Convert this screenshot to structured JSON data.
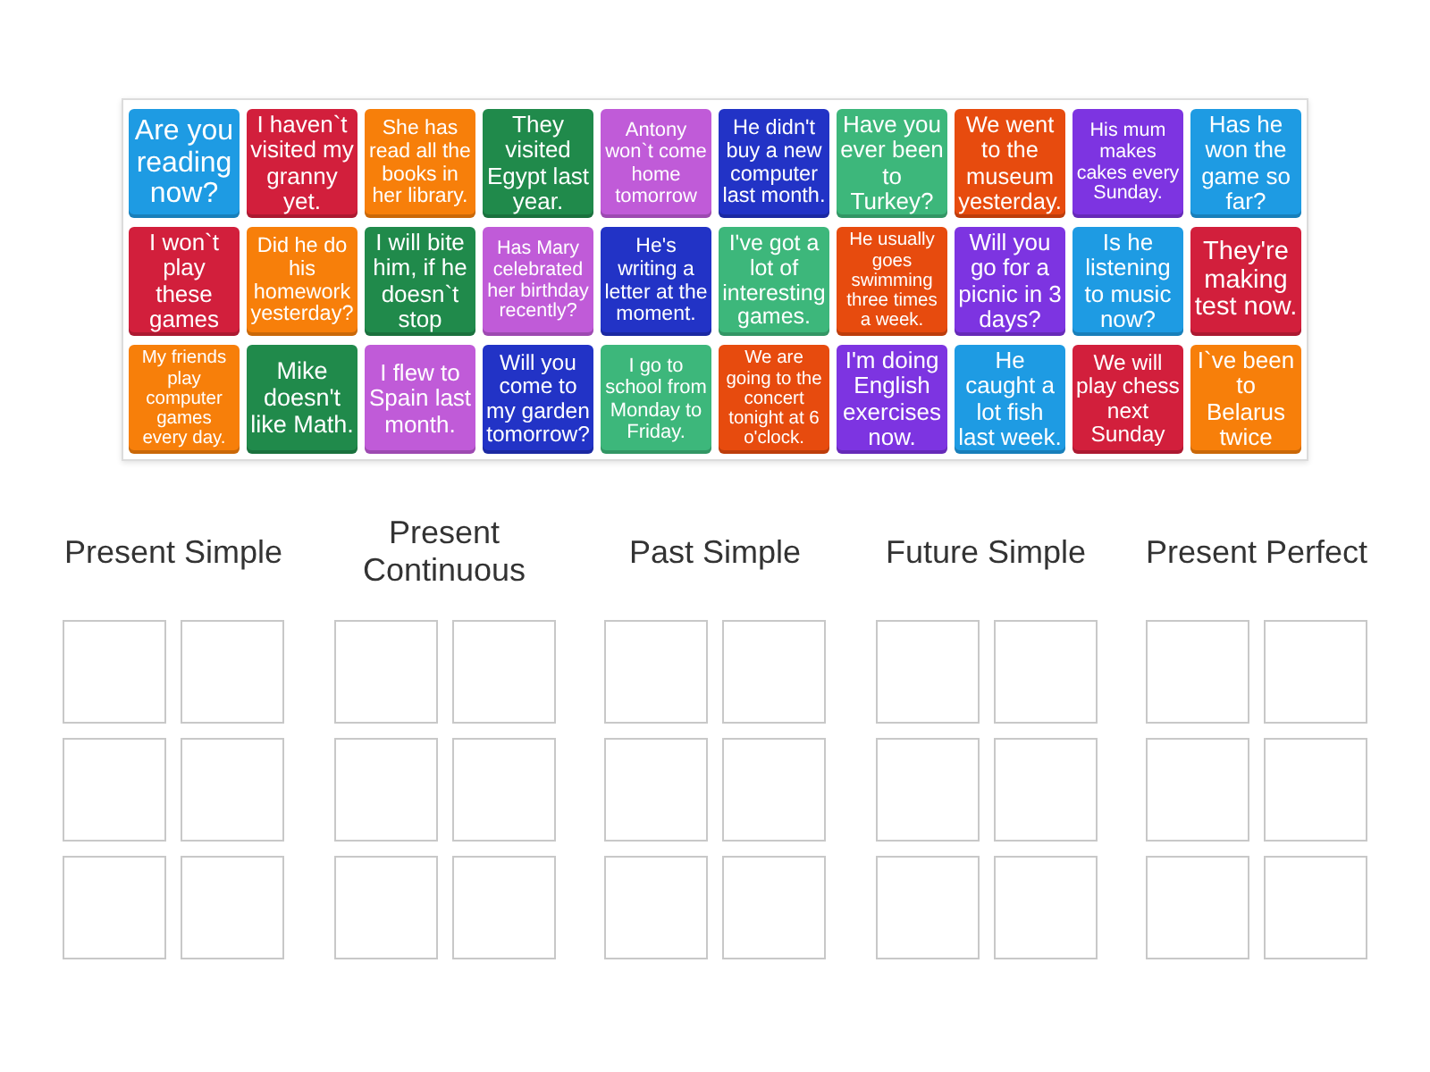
{
  "cards": [
    {
      "text": "Are you reading now?",
      "color": "#1e9be3"
    },
    {
      "text": "I haven`t visited my granny yet.",
      "color": "#d21f3c"
    },
    {
      "text": "She has read all the books in her library.",
      "color": "#f77f0a"
    },
    {
      "text": "They visited Egypt last year.",
      "color": "#208a4b"
    },
    {
      "text": "Antony won`t come home tomorrow",
      "color": "#c05bd8"
    },
    {
      "text": "He didn't buy a new computer last month.",
      "color": "#2233c6"
    },
    {
      "text": "Have you ever been to Turkey?",
      "color": "#3db77b"
    },
    {
      "text": "We went to the museum yesterday.",
      "color": "#e74b0e"
    },
    {
      "text": "His mum makes cakes every Sunday.",
      "color": "#7d34e1"
    },
    {
      "text": "Has he won the game so far?",
      "color": "#1e9be3"
    },
    {
      "text": "I won`t play these games",
      "color": "#d21f3c"
    },
    {
      "text": "Did he do his homework yesterday?",
      "color": "#f77f0a"
    },
    {
      "text": "I will bite him, if he doesn`t stop",
      "color": "#208a4b"
    },
    {
      "text": "Has Mary celebrated her birthday recently?",
      "color": "#c05bd8"
    },
    {
      "text": "He's writing a letter at the moment.",
      "color": "#2233c6"
    },
    {
      "text": "I've got a lot of interesting games.",
      "color": "#3db77b"
    },
    {
      "text": "He usually goes swimming three times a week.",
      "color": "#e74b0e"
    },
    {
      "text": "Will you go for a picnic in 3 days?",
      "color": "#7d34e1"
    },
    {
      "text": "Is he listening to music now?",
      "color": "#1e9be3"
    },
    {
      "text": "They're making test now.",
      "color": "#d21f3c"
    },
    {
      "text": "My friends play computer games every day.",
      "color": "#f77f0a"
    },
    {
      "text": "Mike doesn't like Math.",
      "color": "#208a4b"
    },
    {
      "text": "I flew to Spain last month.",
      "color": "#c05bd8"
    },
    {
      "text": "Will you come to my garden tomorrow?",
      "color": "#2233c6"
    },
    {
      "text": "I go to school from Monday to Friday.",
      "color": "#3db77b"
    },
    {
      "text": "We are going to the concert tonight at 6 o'clock.",
      "color": "#e74b0e"
    },
    {
      "text": "I'm doing English exercises now.",
      "color": "#7d34e1"
    },
    {
      "text": "He caught a lot fish last week.",
      "color": "#1e9be3"
    },
    {
      "text": "We will play chess next Sunday",
      "color": "#d21f3c"
    },
    {
      "text": "I`ve been to Belarus twice",
      "color": "#f77f0a"
    }
  ],
  "categories": [
    {
      "title": "Present Simple"
    },
    {
      "title": "Present Continuous"
    },
    {
      "title": "Past Simple"
    },
    {
      "title": "Future Simple"
    },
    {
      "title": "Present Perfect"
    }
  ]
}
